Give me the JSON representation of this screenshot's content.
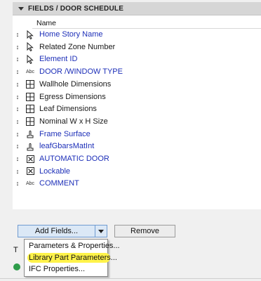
{
  "section": {
    "title": "FIELDS / DOOR SCHEDULE"
  },
  "table": {
    "column_header": "Name"
  },
  "fields": [
    {
      "label": "Home Story Name",
      "icon": "cursor-arrow-icon",
      "color": "blue"
    },
    {
      "label": "Related Zone Number",
      "icon": "cursor-arrow-icon",
      "color": "black"
    },
    {
      "label": "Element ID",
      "icon": "cursor-arrow-icon",
      "color": "blue"
    },
    {
      "label": "DOOR /WINDOW TYPE",
      "icon": "abc-text-icon",
      "color": "blue"
    },
    {
      "label": "Wallhole Dimensions",
      "icon": "grid-frame-icon",
      "color": "black"
    },
    {
      "label": "Egress Dimensions",
      "icon": "grid-frame-icon",
      "color": "black"
    },
    {
      "label": "Leaf Dimensions",
      "icon": "grid-frame-icon",
      "color": "black"
    },
    {
      "label": "Nominal W x H Size",
      "icon": "grid-frame-icon",
      "color": "black"
    },
    {
      "label": "Frame Surface",
      "icon": "hand-brush-icon",
      "color": "blue"
    },
    {
      "label": "leafGbarsMatInt",
      "icon": "hand-brush-icon",
      "color": "blue"
    },
    {
      "label": "AUTOMATIC DOOR",
      "icon": "checkbox-x-icon",
      "color": "blue"
    },
    {
      "label": "Lockable",
      "icon": "checkbox-x-icon",
      "color": "blue"
    },
    {
      "label": "COMMENT",
      "icon": "abc-text-icon",
      "color": "blue"
    }
  ],
  "buttons": {
    "add_fields": "Add Fields...",
    "remove": "Remove"
  },
  "menu": {
    "items": [
      "Parameters & Properties...",
      "Library Part Parameters...",
      "IFC Properties..."
    ],
    "highlighted": "Library Part Parameters..."
  },
  "side": {
    "letter": "T"
  },
  "colors": {
    "blue_text": "#1d2fb8",
    "highlight": "#fff34a",
    "button_accent": "#dbe8f6"
  }
}
